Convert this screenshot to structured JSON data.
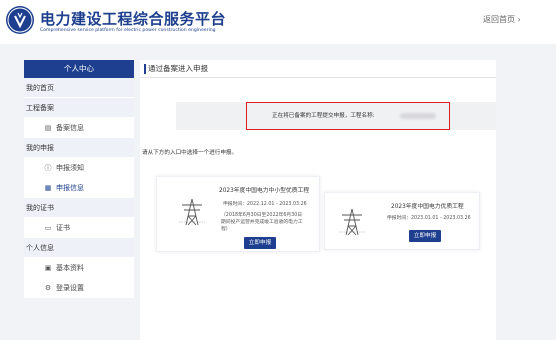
{
  "header": {
    "title": "电力建设工程综合服务平台",
    "subtitle": "Comprehensive service platform for electric power construction engineering",
    "back_home": "返回首页 ›"
  },
  "sidebar": {
    "heading": "个人中心",
    "items": [
      {
        "label": "我的首页"
      },
      {
        "label": "工程备案"
      },
      {
        "label": "备案信息",
        "icon": "document-icon"
      },
      {
        "label": "我的申报"
      },
      {
        "label": "申报须知",
        "icon": "info-icon"
      },
      {
        "label": "申报信息",
        "icon": "list-icon",
        "active": true
      },
      {
        "label": "我的证书"
      },
      {
        "label": "证书",
        "icon": "certificate-icon"
      },
      {
        "label": "个人信息"
      },
      {
        "label": "基本资料",
        "icon": "profile-icon"
      },
      {
        "label": "登录设置",
        "icon": "gear-icon"
      }
    ]
  },
  "main": {
    "title": "通过备案进入申报",
    "notice": "正在将已备案的工程提交申报，工程名称:",
    "instruction": "请从下方的入口中选择一个进行申报。",
    "cards": [
      {
        "title": "2023年度中国电力中小型优质工程",
        "period": "申报时间：2022.12.01 - 2023.03.26",
        "note": "（2018年6月30日至2022年6月30日期间投产运营并完成竣工验收的电力工程）",
        "button": "立即申报"
      },
      {
        "title": "2023年度中国电力优质工程",
        "period": "申报时间：2023.01.01 - 2023.03.26",
        "button": "立即申报"
      }
    ]
  },
  "colors": {
    "brand": "#1e3f8f",
    "highlight": "#e02020",
    "background": "#f1f3f6"
  }
}
